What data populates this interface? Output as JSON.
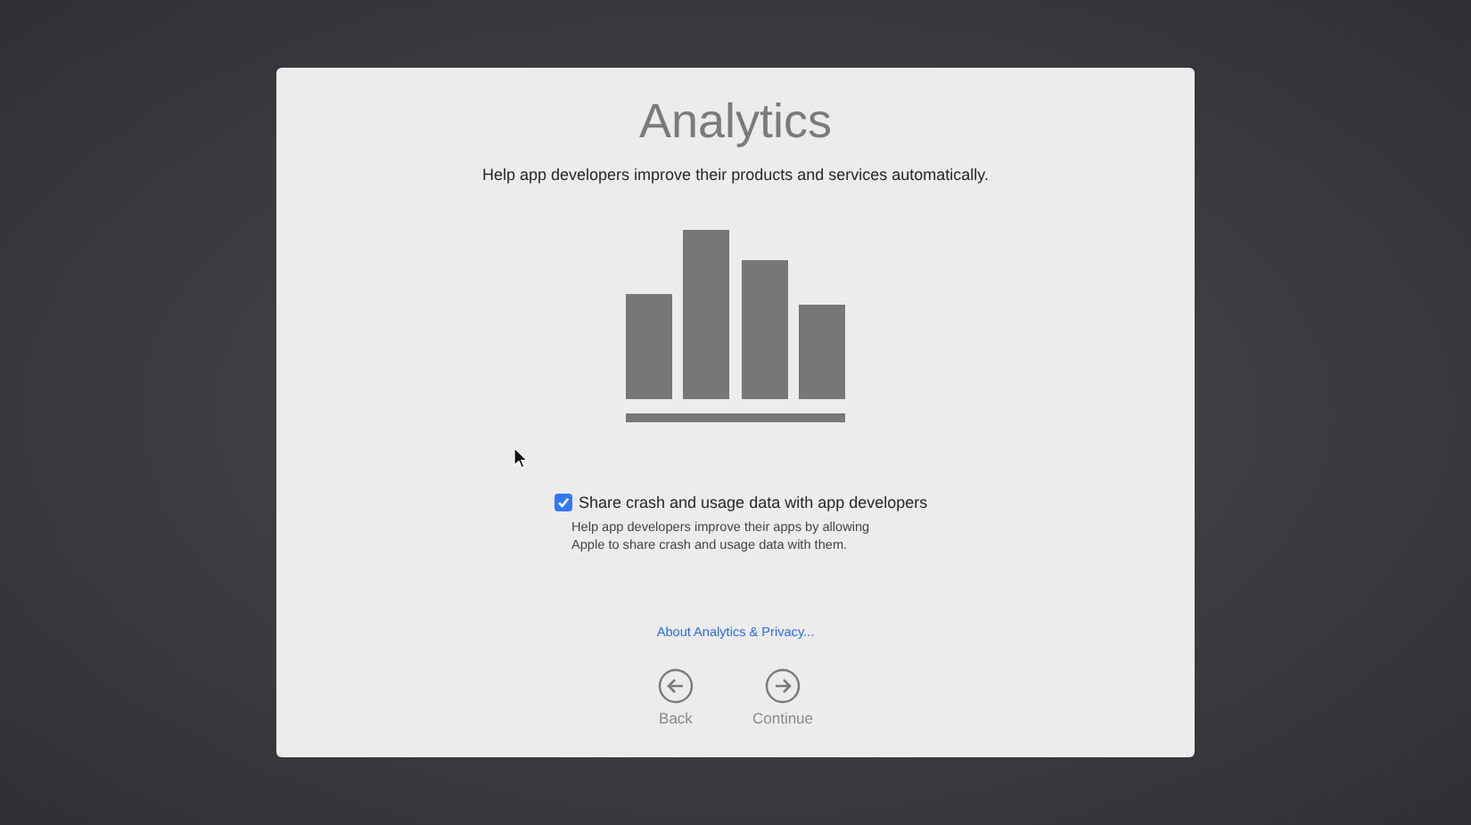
{
  "title": "Analytics",
  "subtitle": "Help app developers improve their products and services automatically.",
  "option": {
    "label": "Share crash and usage data with app developers",
    "checked": true,
    "description": "Help app developers improve their apps by allowing Apple to share crash and usage data with them."
  },
  "link": "About Analytics & Privacy...",
  "buttons": [
    {
      "kind": "back",
      "label": "Back"
    },
    {
      "kind": "continue",
      "label": "Continue"
    }
  ]
}
